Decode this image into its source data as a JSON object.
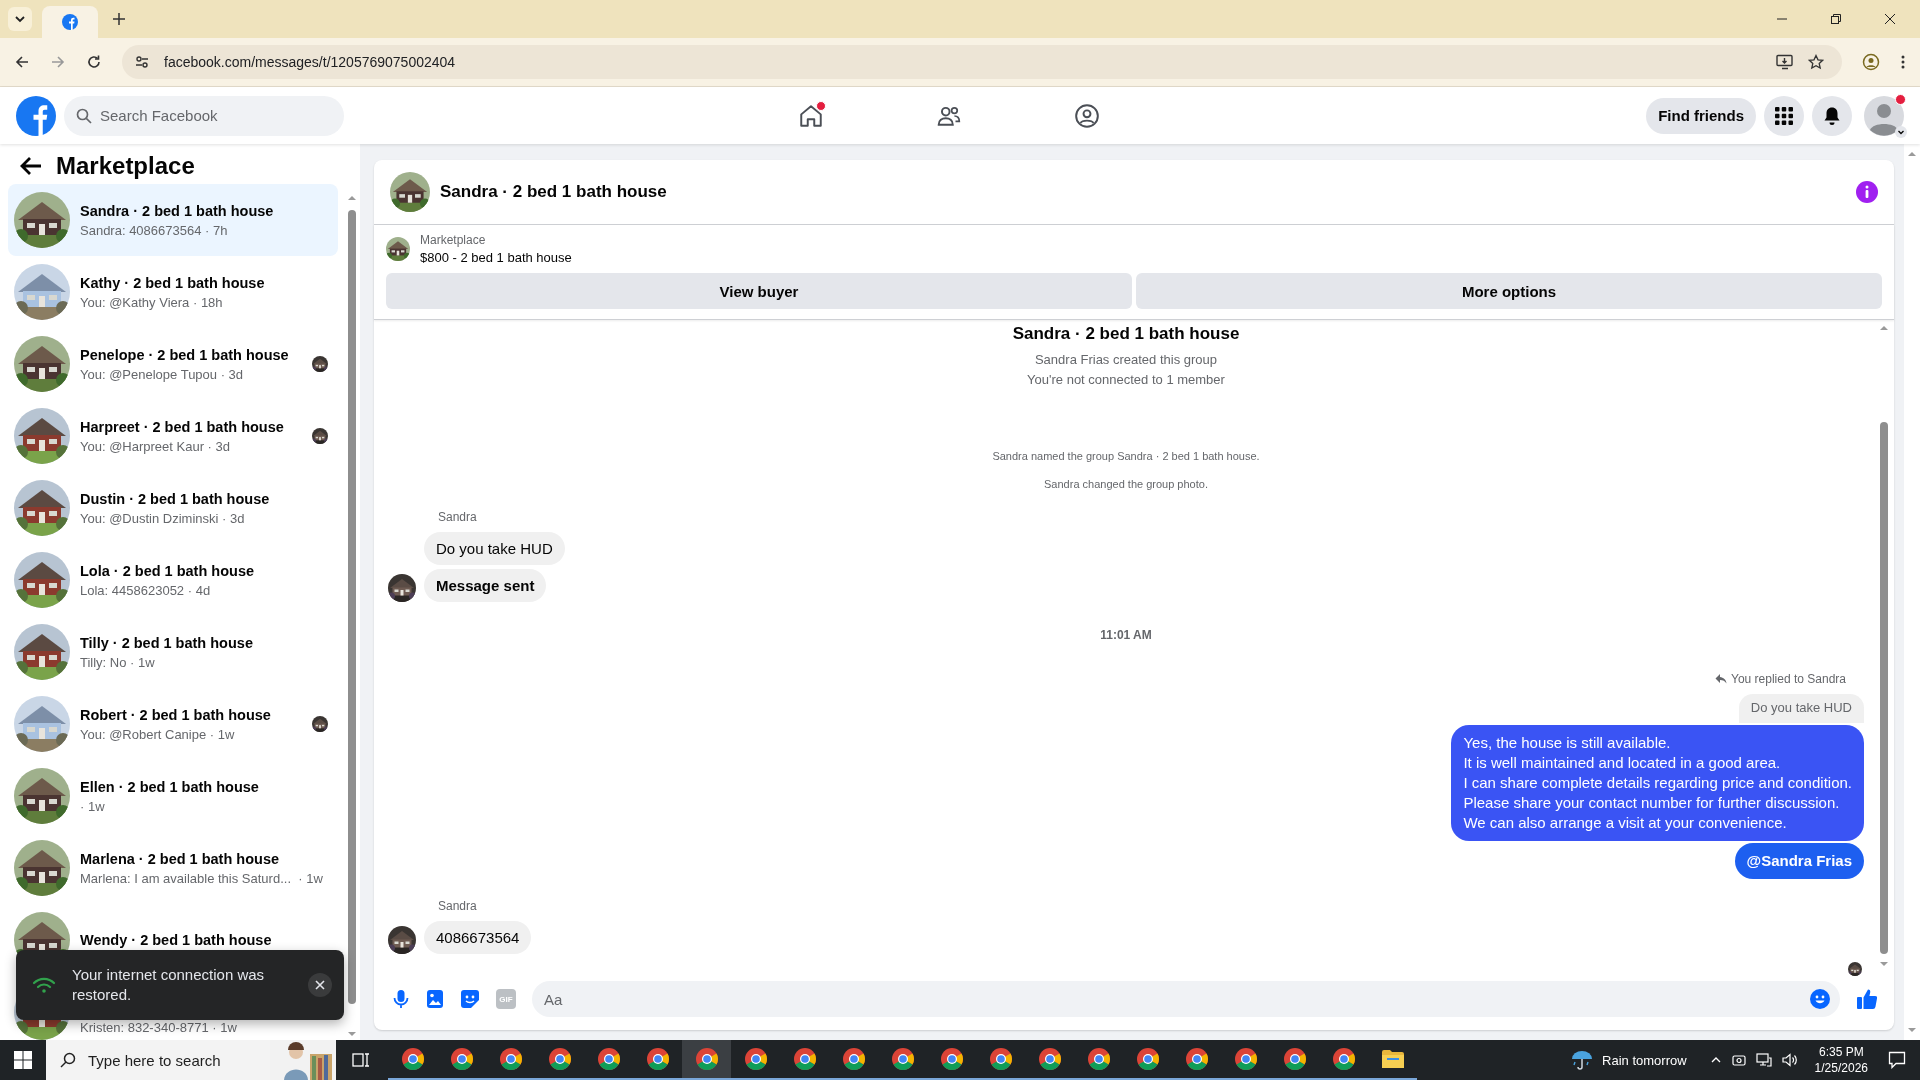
{
  "browser": {
    "tabs": [
      {
        "selected": true
      }
    ],
    "address_bar": {
      "url": "facebook.com/messages/t/1205769075002404"
    }
  },
  "facebook_header": {
    "search": {
      "placeholder": "Search Facebook"
    },
    "nav": [
      {
        "kind": "home",
        "badge": true
      },
      {
        "kind": "friends",
        "badge": false
      },
      {
        "kind": "groups",
        "badge": false
      }
    ],
    "find_friends": "Find friends",
    "account_badge": true
  },
  "sidebar": {
    "title": "Marketplace",
    "conversations": [
      {
        "title": "Sandra · 2 bed 1 bath house",
        "subtitle": "Sandra: 4086673564 · 7h",
        "selected": true,
        "seen": false
      },
      {
        "title": "Kathy · 2 bed 1 bath house",
        "subtitle": "You: @Kathy Viera · 18h",
        "selected": false,
        "seen": false
      },
      {
        "title": "Penelope · 2 bed 1 bath house",
        "subtitle": "You: @Penelope Tupou · 3d",
        "selected": false,
        "seen": true
      },
      {
        "title": "Harpreet · 2 bed 1 bath house",
        "subtitle": "You: @Harpreet Kaur · 3d",
        "selected": false,
        "seen": true
      },
      {
        "title": "Dustin · 2 bed 1 bath house",
        "subtitle": "You: @Dustin Dziminski · 3d",
        "selected": false,
        "seen": false
      },
      {
        "title": "Lola · 2 bed 1 bath house",
        "subtitle": "Lola: 4458623052 · 4d",
        "selected": false,
        "seen": false
      },
      {
        "title": "Tilly · 2 bed 1 bath house",
        "subtitle": "Tilly: No · 1w",
        "selected": false,
        "seen": false
      },
      {
        "title": "Robert · 2 bed 1 bath house",
        "subtitle": "You: @Robert Canipe · 1w",
        "selected": false,
        "seen": true
      },
      {
        "title": "Ellen · 2 bed 1 bath house",
        "subtitle": "· 1w",
        "selected": false,
        "seen": false
      },
      {
        "title": "Marlena · 2 bed 1 bath house",
        "subtitle": "Marlena: I am available this Saturd...  · 1w",
        "selected": false,
        "seen": false
      },
      {
        "title": "Wendy · 2 bed 1 bath house",
        "selected": false,
        "seen": false
      },
      {
        "subtitle": "Kristen: 832-340-8771 · 1w",
        "selected": false,
        "seen": false
      }
    ]
  },
  "toast": {
    "message": "Your internet connection was restored."
  },
  "chat": {
    "title": "Sandra · 2 bed 1 bath house",
    "listing": {
      "label": "Marketplace",
      "detail": "$800 - 2 bed 1 bath house"
    },
    "buttons": [
      "View buyer",
      "More options"
    ],
    "messages": [
      {
        "kind": "title",
        "text": "Sandra · 2 bed 1 bath house"
      },
      {
        "kind": "event",
        "text": "Sandra Frias created this group"
      },
      {
        "kind": "event",
        "text": "You're not connected to 1 member"
      },
      {
        "kind": "notice",
        "text": "Sandra named the group Sandra · 2 bed 1 bath house."
      },
      {
        "kind": "notice",
        "text": "Sandra changed the group photo."
      },
      {
        "kind": "sender",
        "text": "Sandra"
      },
      {
        "kind": "incoming",
        "text": "Do you take HUD",
        "bold": false,
        "avatar": false
      },
      {
        "kind": "incoming",
        "text": "Message sent",
        "bold": true,
        "avatar": true
      },
      {
        "kind": "timestamp",
        "text": "11:01 AM"
      },
      {
        "kind": "reply_note",
        "text": "You replied to Sandra"
      },
      {
        "kind": "quote",
        "text": "Do you take HUD"
      },
      {
        "kind": "outgoing",
        "text": "Yes, the house is still available.\nIt is well maintained and located in a good area.\nI can share complete details regarding price and condition.\nPlease share your contact number for further discussion.\nWe can also arrange a visit at your convenience.",
        "bold": false
      },
      {
        "kind": "outgoing",
        "text": "@Sandra Frias",
        "bold": true
      },
      {
        "kind": "sender",
        "text": "Sandra"
      },
      {
        "kind": "incoming",
        "text": "4086673564",
        "bold": false,
        "avatar": true
      },
      {
        "kind": "read_receipt"
      }
    ],
    "composer": {
      "placeholder": "Aa",
      "gif_label": "GIF"
    }
  },
  "taskbar": {
    "search": {
      "placeholder": "Type here to search"
    },
    "apps": [
      {
        "kind": "browser",
        "selected": false
      },
      {
        "kind": "browser",
        "selected": false
      },
      {
        "kind": "browser",
        "selected": false
      },
      {
        "kind": "browser",
        "selected": false
      },
      {
        "kind": "browser",
        "selected": false
      },
      {
        "kind": "browser",
        "selected": false
      },
      {
        "kind": "browser",
        "selected": true
      },
      {
        "kind": "browser",
        "selected": false
      },
      {
        "kind": "browser",
        "selected": false
      },
      {
        "kind": "browser",
        "selected": false
      },
      {
        "kind": "browser",
        "selected": false
      },
      {
        "kind": "browser",
        "selected": false
      },
      {
        "kind": "browser",
        "selected": false
      },
      {
        "kind": "browser",
        "selected": false
      },
      {
        "kind": "browser",
        "selected": false
      },
      {
        "kind": "browser",
        "selected": false
      },
      {
        "kind": "browser",
        "selected": false
      },
      {
        "kind": "browser",
        "selected": false
      },
      {
        "kind": "browser",
        "selected": false
      },
      {
        "kind": "browser",
        "selected": false
      },
      {
        "kind": "folder",
        "selected": false
      }
    ],
    "weather": "Rain tomorrow",
    "time": "6:35 PM",
    "date": "1/25/2026"
  }
}
